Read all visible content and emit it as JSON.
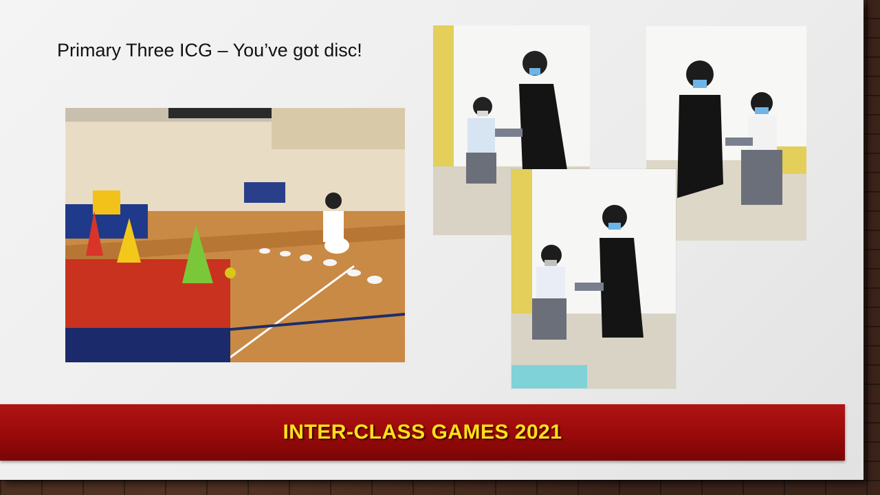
{
  "slide": {
    "title": "Primary Three ICG – You’ve got disc!",
    "banner_text": "INTER-CLASS GAMES 2021"
  },
  "colors": {
    "banner": "#9e0b0b",
    "banner_text": "#ffe21a",
    "background": "#4b2f22"
  },
  "photos": [
    {
      "name": "gym-disc-game-photo"
    },
    {
      "name": "award-presentation-photo-1"
    },
    {
      "name": "award-presentation-photo-2"
    },
    {
      "name": "award-presentation-photo-3"
    }
  ]
}
